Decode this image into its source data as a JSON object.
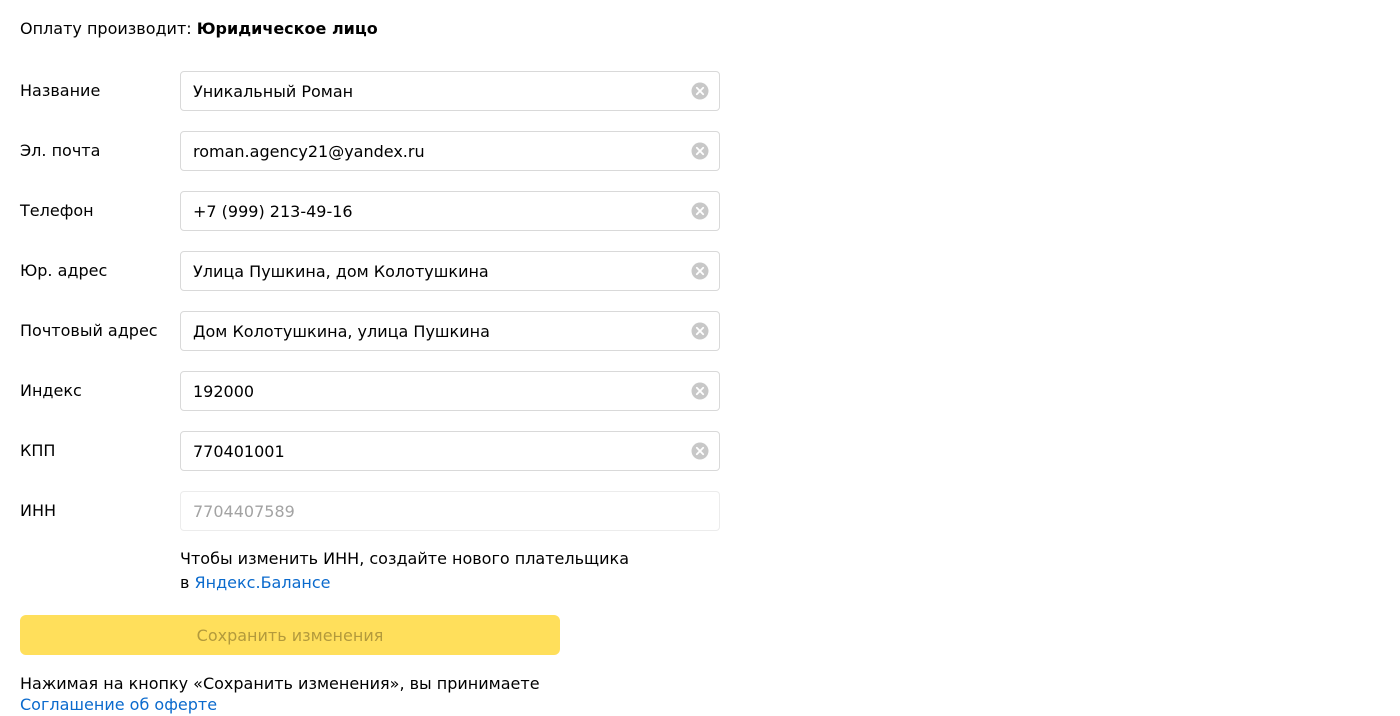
{
  "payer": {
    "label": "Оплату производит:",
    "value": "Юридическое лицо"
  },
  "fields": [
    {
      "label": "Название",
      "value": "Уникальный Роман",
      "placeholder": "",
      "disabled": false
    },
    {
      "label": "Эл. почта",
      "value": "roman.agency21@yandex.ru",
      "placeholder": "",
      "disabled": false
    },
    {
      "label": "Телефон",
      "value": "+7 (999) 213-49-16",
      "placeholder": "",
      "disabled": false
    },
    {
      "label": "Юр. адрес",
      "value": "Улица Пушкина, дом Колотушкина",
      "placeholder": "",
      "disabled": false
    },
    {
      "label": "Почтовый адрес",
      "value": "Дом Колотушкина, улица Пушкина",
      "placeholder": "",
      "disabled": false
    },
    {
      "label": "Индекс",
      "value": "192000",
      "placeholder": "",
      "disabled": false
    },
    {
      "label": "КПП",
      "value": "770401001",
      "placeholder": "",
      "disabled": false
    },
    {
      "label": "ИНН",
      "value": "",
      "placeholder": "7704407589",
      "disabled": true
    }
  ],
  "hint": {
    "line1": "Чтобы изменить ИНН, создайте нового плательщика",
    "prefix": "в",
    "link": "Яндекс.Балансе"
  },
  "save_button": {
    "label": "Сохранить изменения",
    "disabled": true
  },
  "terms": {
    "text": "Нажимая на кнопку «Сохранить изменения», вы принимаете",
    "link": "Соглашение об оферте"
  },
  "icons": {
    "clear": "clear-circle-icon"
  },
  "colors": {
    "accent_button": "#ffdf5b",
    "accent_button_text": "#b39a3c",
    "link": "#0a6acd",
    "border": "#d9d9d9"
  }
}
